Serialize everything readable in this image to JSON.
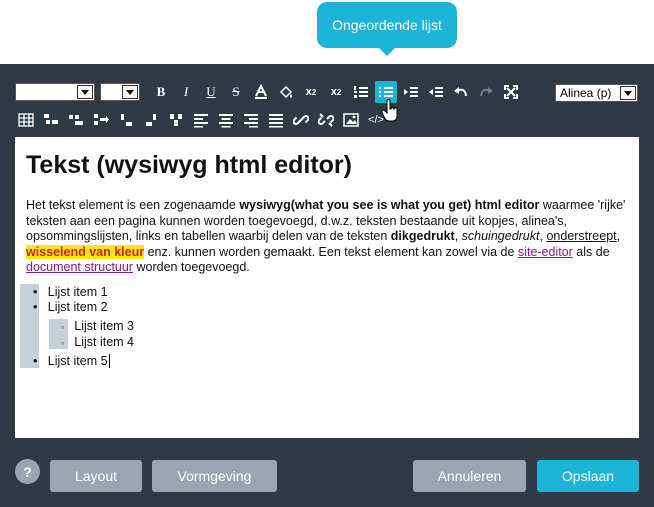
{
  "tooltip": {
    "text": "Ongeordende lijst"
  },
  "toolbar": {
    "format_select": {
      "value": "Alinea (p)"
    }
  },
  "editor": {
    "heading": "Tekst (wysiwyg html editor)",
    "paragraph": {
      "intro": "Het tekst element is een zogenaamde ",
      "bold1": "wysiwyg(what you see is what you get) html editor",
      "line2": " waarmee 'rijke' teksten aan een pagina kunnen worden toegevoegd, d.w.z. teksten bestaande uit kopjes, alinea's, opsommingslijsten, links en tabellen waarbij delen van de teksten ",
      "bold2": "dikgedrukt",
      "comma": ", ",
      "italic": "schuingedrukt",
      "comma2": ", ",
      "underline": "onderstreept",
      "comma3": ", ",
      "highlight": "wisselend van kleur",
      "mid": " enz. kunnen worden gemaakt. Een tekst element kan zowel via de ",
      "link1": "site-editor",
      "als": " als de ",
      "link2": "document structuur",
      "end": " worden toegevoegd."
    },
    "list": {
      "item1": "Lijst item 1",
      "item2": "Lijst item 2",
      "item3": "Lijst item 3",
      "item4": "Lijst item 4",
      "item5": "Lijst item 5"
    }
  },
  "footer": {
    "help": "?",
    "layout": "Layout",
    "vormgeving": "Vormgeving",
    "annuleren": "Annuleren",
    "opslaan": "Opslaan"
  },
  "colors": {
    "accent": "#1cb4d8",
    "panel": "#2f3a45",
    "button_grey": "#9aa5b0"
  }
}
